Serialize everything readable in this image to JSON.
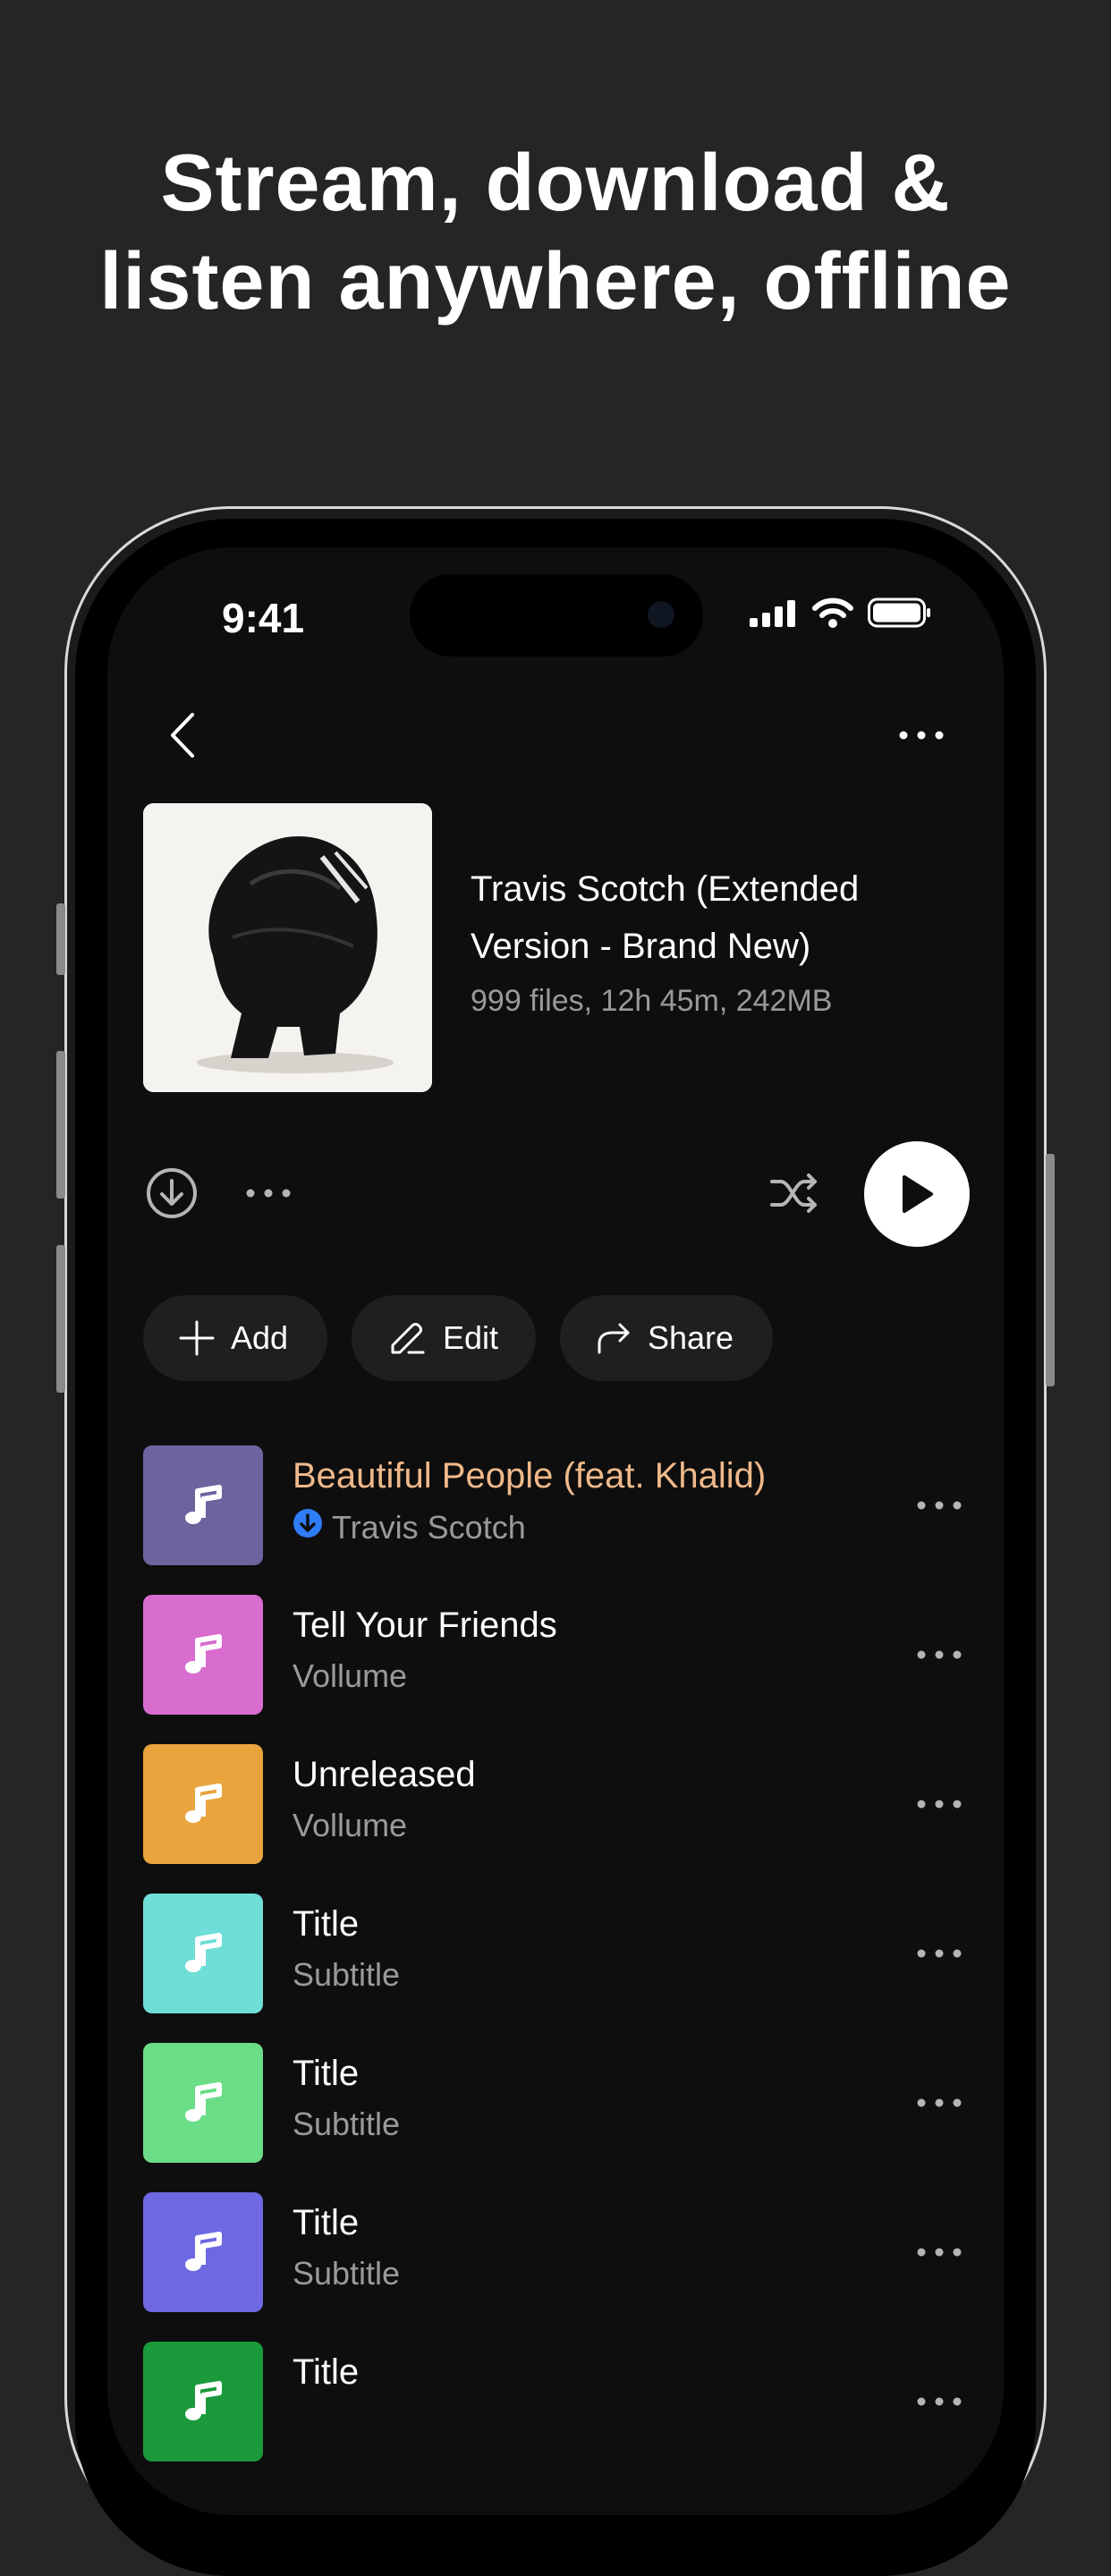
{
  "headline": {
    "line1": "Stream, download &",
    "line2": "listen anywhere, offline"
  },
  "status_bar": {
    "time": "9:41",
    "icons": [
      "signal-icon",
      "wifi-icon",
      "battery-icon"
    ]
  },
  "nav": {
    "back_icon": "chevron-left-icon",
    "more_icon": "more-horizontal-icon"
  },
  "album": {
    "title": "Travis Scotch (Extended Version - Brand New)",
    "meta": "999 files, 12h 45m, 242MB"
  },
  "controls": {
    "download_icon": "download-circle-icon",
    "more_icon": "more-horizontal-icon",
    "shuffle_icon": "shuffle-icon",
    "play_icon": "play-icon"
  },
  "chips": [
    {
      "label": "Add",
      "icon": "plus-icon"
    },
    {
      "label": "Edit",
      "icon": "pencil-icon"
    },
    {
      "label": "Share",
      "icon": "share-arrow-icon"
    }
  ],
  "tracks": [
    {
      "title": "Beautiful People (feat. Khalid)",
      "subtitle": "Travis Scotch",
      "color": "#6b649f",
      "active": true,
      "downloaded": true
    },
    {
      "title": "Tell Your Friends",
      "subtitle": "Vollume",
      "color": "#d86ccf"
    },
    {
      "title": "Unreleased",
      "subtitle": "Vollume",
      "color": "#e9a43d"
    },
    {
      "title": "Title",
      "subtitle": "Subtitle",
      "color": "#6fded7"
    },
    {
      "title": "Title",
      "subtitle": "Subtitle",
      "color": "#6bdd86"
    },
    {
      "title": "Title",
      "subtitle": "Subtitle",
      "color": "#6e68e3"
    },
    {
      "title": "Title",
      "subtitle": "",
      "color": "#1a9a3b"
    }
  ],
  "colors": {
    "background": "#252525",
    "screen": "#0e0e0f",
    "active_title": "#f0b98a",
    "download_badge": "#2f7df6",
    "secondary_text": "#9a9a9a"
  }
}
